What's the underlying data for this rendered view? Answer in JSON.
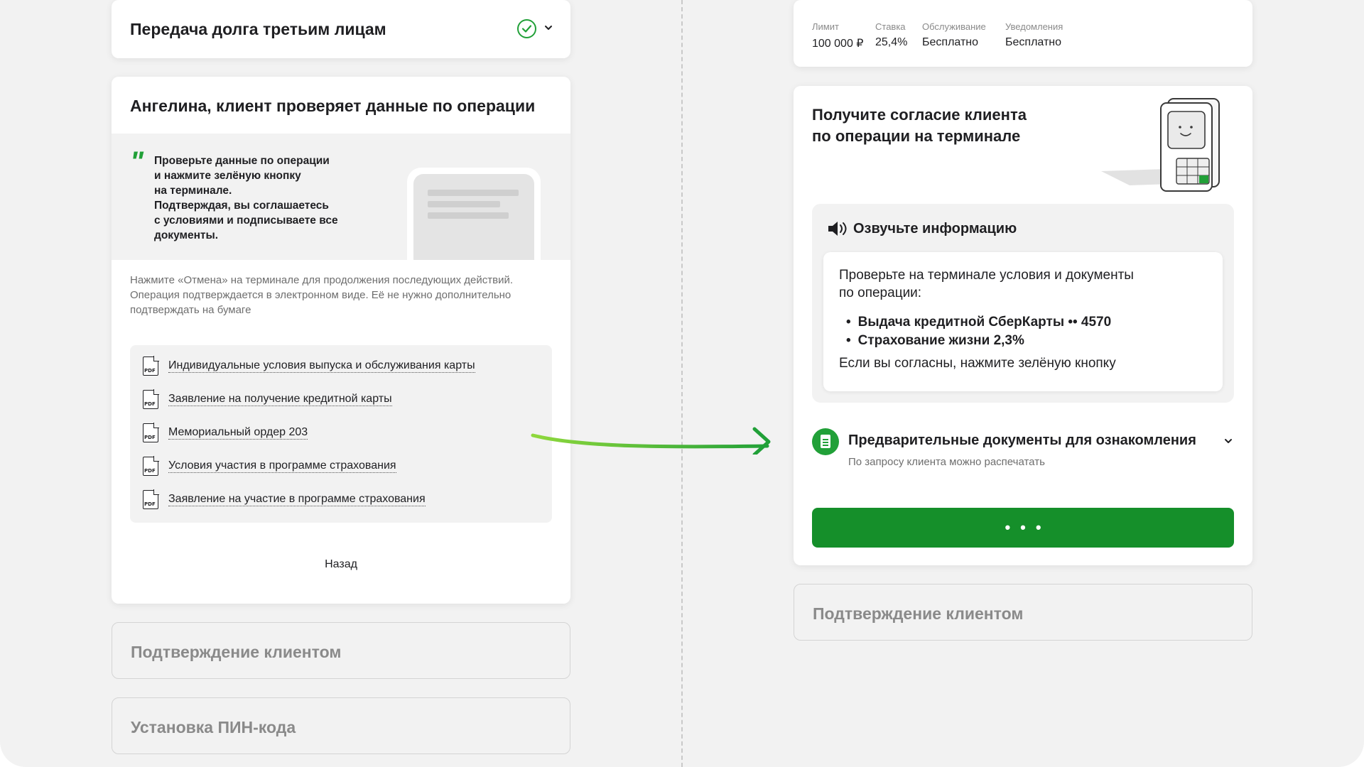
{
  "left": {
    "debt_step": {
      "title": "Передача долга третьим лицам"
    },
    "main": {
      "title": "Ангелина, клиент проверяет данные по операции",
      "quote": "Проверьте данные по операции\nи нажмите зелёную кнопку\nна терминале.\nПодтверждая, вы соглашаетесь\nс условиями и подписываете все\nдокументы.",
      "info_1": "Нажмите «Отмена» на терминале для продолжения последующих действий.",
      "info_2": "Операция подтверждается в электронном виде. Её не нужно дополнительно подтверждать на бумаге",
      "documents": [
        "Индивидуальные условия выпуска и обслуживания карты",
        "Заявление на получение кредитной карты",
        "Мемориальный ордер 203",
        "Условия участия в программе страхования",
        "Заявление на участие в программе страхования"
      ],
      "pdf_label": "PDF",
      "back_label": "Назад"
    },
    "confirm_step": {
      "title": "Подтверждение клиентом"
    },
    "pin_step": {
      "title": "Установка ПИН-кода"
    }
  },
  "right": {
    "summary": {
      "limit_label": "Лимит",
      "limit_value": "100 000 ₽",
      "rate_label": "Ставка",
      "rate_value": "25,4%",
      "service_label": "Обслуживание",
      "service_value": "Бесплатно",
      "notify_label": "Уведомления",
      "notify_value": "Бесплатно"
    },
    "main": {
      "title": "Получите согласие клиента\nпо операции на терминале",
      "voice_title": "Озвучьте информацию",
      "voice_intro": "Проверьте на терминале условия и документы\nпо операции:",
      "items": [
        "Выдача кредитной СберКарты  •• 4570",
        "Страхование жизни 2,3%"
      ],
      "voice_outro": "Если вы согласны, нажмите зелёную кнопку",
      "prelim_title": "Предварительные документы для ознакомления",
      "prelim_sub": "По запросу клиента можно распечатать",
      "button_label": "•••"
    },
    "confirm_step": {
      "title": "Подтверждение клиентом"
    }
  },
  "colors": {
    "accent": "#21a038",
    "button": "#158f2a",
    "muted": "#8a8a8a"
  }
}
